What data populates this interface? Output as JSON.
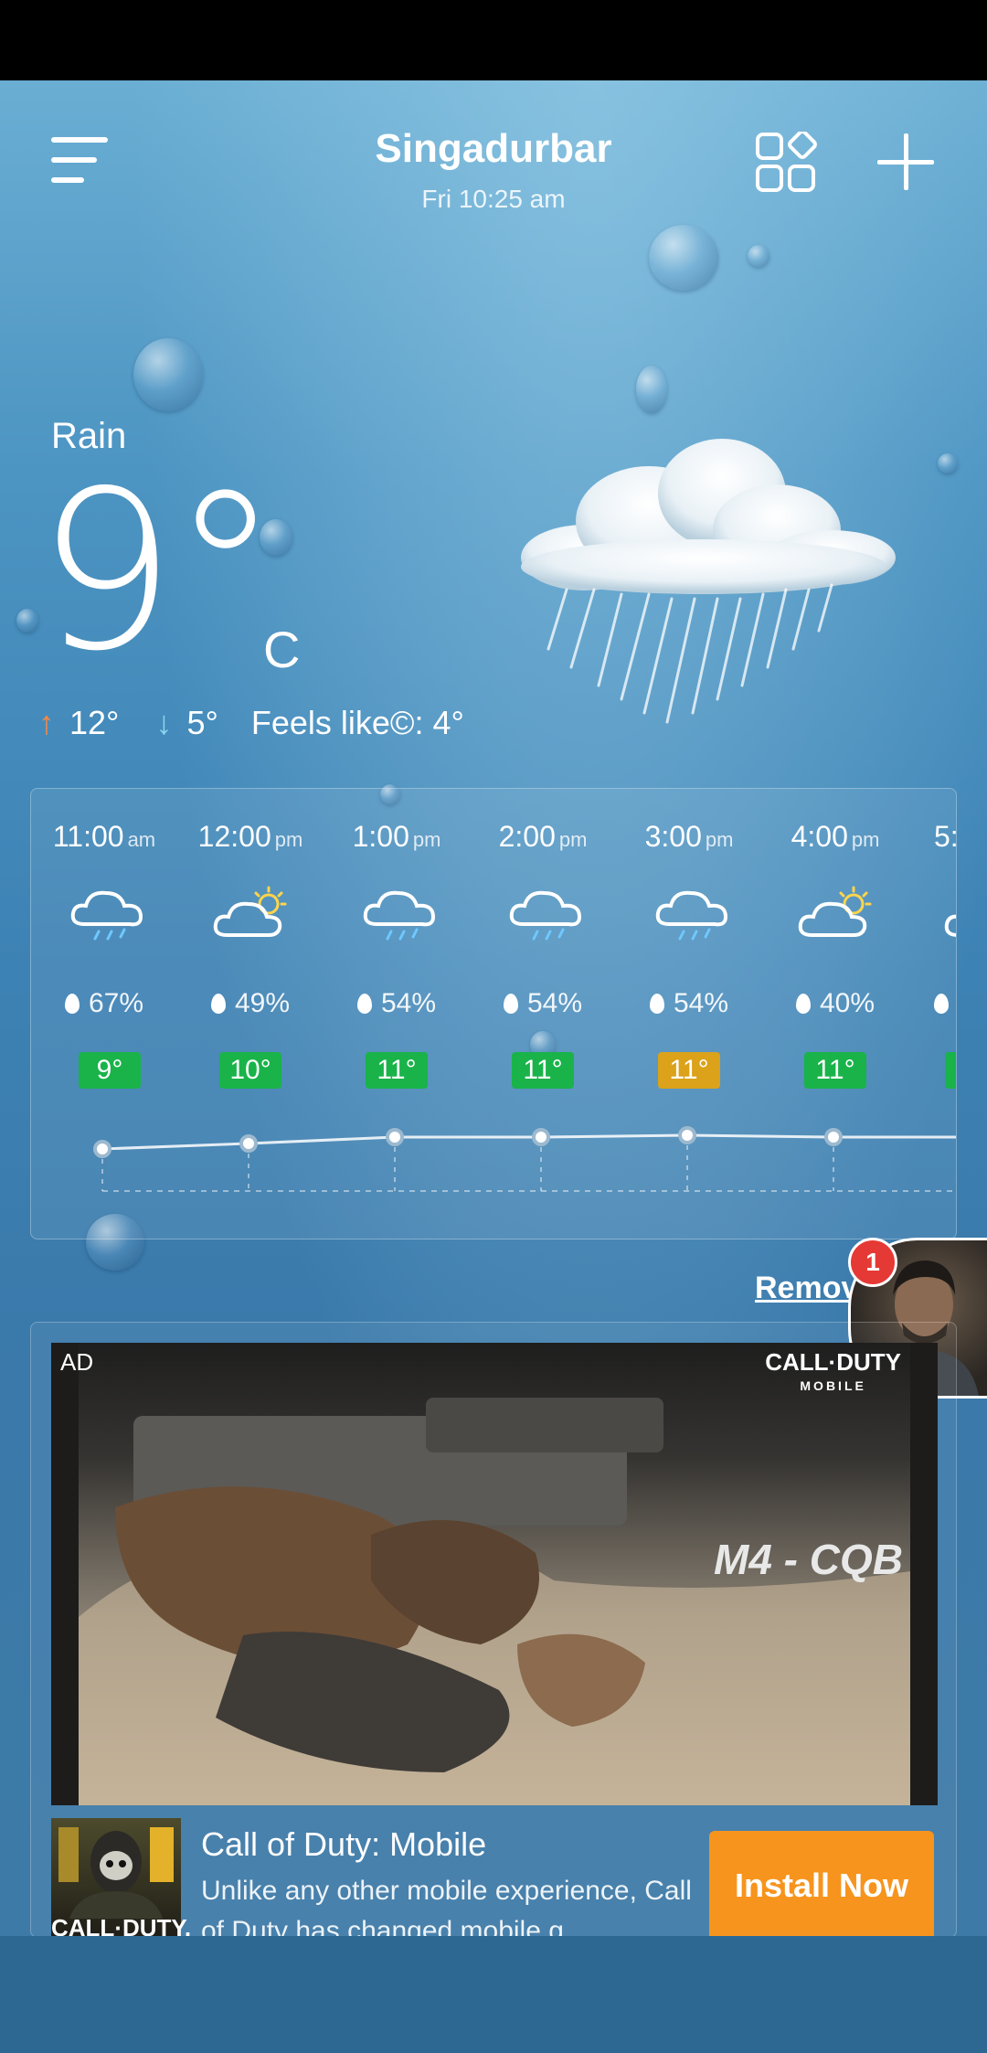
{
  "header": {
    "city": "Singadurbar",
    "datetime": "Fri 10:25 am"
  },
  "current": {
    "condition": "Rain",
    "temperature": "9°",
    "unit": "C",
    "high": "12°",
    "low": "5°",
    "feels_like": "Feels like©: 4°",
    "icon": "rain-cloud-icon"
  },
  "hourly": [
    {
      "time": "11:00",
      "ampm": "am",
      "icon": "rain-cloud-icon",
      "precip": "67%",
      "temp": "9°",
      "badge_color": "#19b34a"
    },
    {
      "time": "12:00",
      "ampm": "pm",
      "icon": "partly-cloudy-icon",
      "precip": "49%",
      "temp": "10°",
      "badge_color": "#19b34a"
    },
    {
      "time": "1:00",
      "ampm": "pm",
      "icon": "rain-cloud-icon",
      "precip": "54%",
      "temp": "11°",
      "badge_color": "#19b34a"
    },
    {
      "time": "2:00",
      "ampm": "pm",
      "icon": "rain-cloud-icon",
      "precip": "54%",
      "temp": "11°",
      "badge_color": "#19b34a"
    },
    {
      "time": "3:00",
      "ampm": "pm",
      "icon": "rain-cloud-icon",
      "precip": "54%",
      "temp": "11°",
      "badge_color": "#dba21a"
    },
    {
      "time": "4:00",
      "ampm": "pm",
      "icon": "partly-cloudy-icon",
      "precip": "40%",
      "temp": "11°",
      "badge_color": "#19b34a"
    },
    {
      "time": "5:",
      "ampm": "",
      "icon": "partly-cloudy-icon",
      "precip": "",
      "temp": "",
      "badge_color": "#19b34a"
    }
  ],
  "ads": {
    "remove_label": "Remov",
    "notification_count": "1",
    "ad_label": "AD",
    "media_logo_line1": "CALL·DUTY",
    "media_logo_line2": "MOBILE",
    "media_caption": "M4 - CQB",
    "icon_text": "CALL·DUTY.",
    "title": "Call of Duty: Mobile",
    "description": "Unlike any other mobile experience, Call of Duty has changed mobile g",
    "install_label": "Install Now"
  },
  "colors": {
    "accent_up": "#f08a4b",
    "accent_down": "#8cd3ee",
    "badge_green": "#19b34a",
    "badge_yellow": "#dba21a",
    "install_orange": "#f7941d"
  }
}
